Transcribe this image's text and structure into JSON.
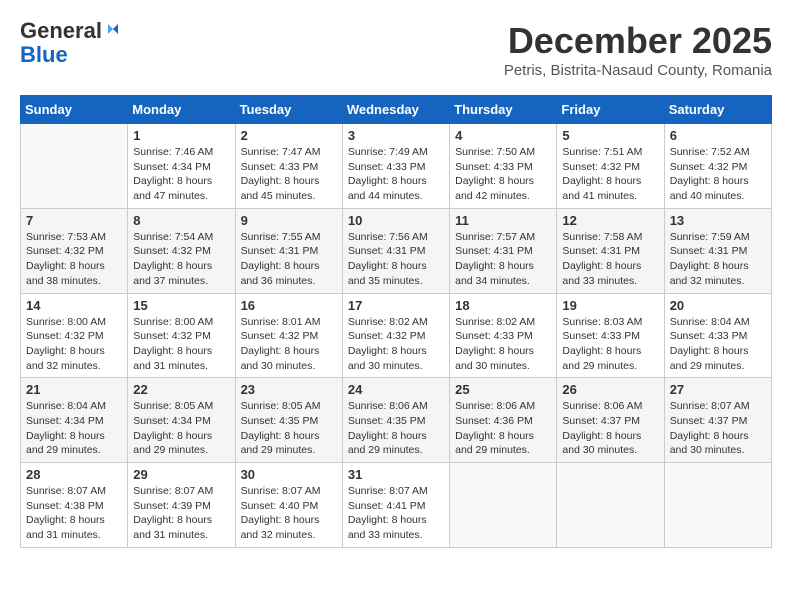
{
  "logo": {
    "line1_general": "General",
    "line2_blue": "Blue"
  },
  "title": {
    "month": "December 2025",
    "subtitle": "Petris, Bistrita-Nasaud County, Romania"
  },
  "weekdays": [
    "Sunday",
    "Monday",
    "Tuesday",
    "Wednesday",
    "Thursday",
    "Friday",
    "Saturday"
  ],
  "weeks": [
    [
      {
        "day": "",
        "info": ""
      },
      {
        "day": "1",
        "sunrise": "7:46 AM",
        "sunset": "4:34 PM",
        "daylight": "8 hours and 47 minutes."
      },
      {
        "day": "2",
        "sunrise": "7:47 AM",
        "sunset": "4:33 PM",
        "daylight": "8 hours and 45 minutes."
      },
      {
        "day": "3",
        "sunrise": "7:49 AM",
        "sunset": "4:33 PM",
        "daylight": "8 hours and 44 minutes."
      },
      {
        "day": "4",
        "sunrise": "7:50 AM",
        "sunset": "4:33 PM",
        "daylight": "8 hours and 42 minutes."
      },
      {
        "day": "5",
        "sunrise": "7:51 AM",
        "sunset": "4:32 PM",
        "daylight": "8 hours and 41 minutes."
      },
      {
        "day": "6",
        "sunrise": "7:52 AM",
        "sunset": "4:32 PM",
        "daylight": "8 hours and 40 minutes."
      }
    ],
    [
      {
        "day": "7",
        "sunrise": "7:53 AM",
        "sunset": "4:32 PM",
        "daylight": "8 hours and 38 minutes."
      },
      {
        "day": "8",
        "sunrise": "7:54 AM",
        "sunset": "4:32 PM",
        "daylight": "8 hours and 37 minutes."
      },
      {
        "day": "9",
        "sunrise": "7:55 AM",
        "sunset": "4:31 PM",
        "daylight": "8 hours and 36 minutes."
      },
      {
        "day": "10",
        "sunrise": "7:56 AM",
        "sunset": "4:31 PM",
        "daylight": "8 hours and 35 minutes."
      },
      {
        "day": "11",
        "sunrise": "7:57 AM",
        "sunset": "4:31 PM",
        "daylight": "8 hours and 34 minutes."
      },
      {
        "day": "12",
        "sunrise": "7:58 AM",
        "sunset": "4:31 PM",
        "daylight": "8 hours and 33 minutes."
      },
      {
        "day": "13",
        "sunrise": "7:59 AM",
        "sunset": "4:31 PM",
        "daylight": "8 hours and 32 minutes."
      }
    ],
    [
      {
        "day": "14",
        "sunrise": "8:00 AM",
        "sunset": "4:32 PM",
        "daylight": "8 hours and 32 minutes."
      },
      {
        "day": "15",
        "sunrise": "8:00 AM",
        "sunset": "4:32 PM",
        "daylight": "8 hours and 31 minutes."
      },
      {
        "day": "16",
        "sunrise": "8:01 AM",
        "sunset": "4:32 PM",
        "daylight": "8 hours and 30 minutes."
      },
      {
        "day": "17",
        "sunrise": "8:02 AM",
        "sunset": "4:32 PM",
        "daylight": "8 hours and 30 minutes."
      },
      {
        "day": "18",
        "sunrise": "8:02 AM",
        "sunset": "4:33 PM",
        "daylight": "8 hours and 30 minutes."
      },
      {
        "day": "19",
        "sunrise": "8:03 AM",
        "sunset": "4:33 PM",
        "daylight": "8 hours and 29 minutes."
      },
      {
        "day": "20",
        "sunrise": "8:04 AM",
        "sunset": "4:33 PM",
        "daylight": "8 hours and 29 minutes."
      }
    ],
    [
      {
        "day": "21",
        "sunrise": "8:04 AM",
        "sunset": "4:34 PM",
        "daylight": "8 hours and 29 minutes."
      },
      {
        "day": "22",
        "sunrise": "8:05 AM",
        "sunset": "4:34 PM",
        "daylight": "8 hours and 29 minutes."
      },
      {
        "day": "23",
        "sunrise": "8:05 AM",
        "sunset": "4:35 PM",
        "daylight": "8 hours and 29 minutes."
      },
      {
        "day": "24",
        "sunrise": "8:06 AM",
        "sunset": "4:35 PM",
        "daylight": "8 hours and 29 minutes."
      },
      {
        "day": "25",
        "sunrise": "8:06 AM",
        "sunset": "4:36 PM",
        "daylight": "8 hours and 29 minutes."
      },
      {
        "day": "26",
        "sunrise": "8:06 AM",
        "sunset": "4:37 PM",
        "daylight": "8 hours and 30 minutes."
      },
      {
        "day": "27",
        "sunrise": "8:07 AM",
        "sunset": "4:37 PM",
        "daylight": "8 hours and 30 minutes."
      }
    ],
    [
      {
        "day": "28",
        "sunrise": "8:07 AM",
        "sunset": "4:38 PM",
        "daylight": "8 hours and 31 minutes."
      },
      {
        "day": "29",
        "sunrise": "8:07 AM",
        "sunset": "4:39 PM",
        "daylight": "8 hours and 31 minutes."
      },
      {
        "day": "30",
        "sunrise": "8:07 AM",
        "sunset": "4:40 PM",
        "daylight": "8 hours and 32 minutes."
      },
      {
        "day": "31",
        "sunrise": "8:07 AM",
        "sunset": "4:41 PM",
        "daylight": "8 hours and 33 minutes."
      },
      {
        "day": "",
        "info": ""
      },
      {
        "day": "",
        "info": ""
      },
      {
        "day": "",
        "info": ""
      }
    ]
  ]
}
